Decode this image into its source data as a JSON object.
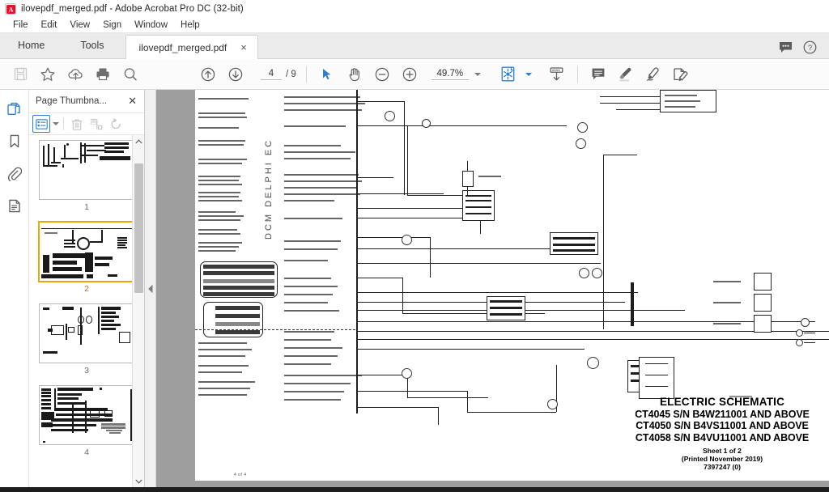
{
  "window": {
    "title": "ilovepdf_merged.pdf - Adobe Acrobat Pro DC (32-bit)",
    "app_icon": "acrobat-logo-icon"
  },
  "menubar": {
    "items": [
      {
        "label": "File"
      },
      {
        "label": "Edit"
      },
      {
        "label": "View"
      },
      {
        "label": "Sign"
      },
      {
        "label": "Window"
      },
      {
        "label": "Help"
      }
    ]
  },
  "tabstrip": {
    "home_label": "Home",
    "tools_label": "Tools",
    "document_tab": "ilovepdf_merged.pdf",
    "close_glyph": "×",
    "right_icons": [
      {
        "name": "feedback-icon"
      },
      {
        "name": "help-icon"
      }
    ]
  },
  "toolbar": {
    "save_tooltip": "Save",
    "add_to_favorites_tooltip": "Add to Favorites",
    "upload_tooltip": "Send file",
    "print_tooltip": "Print File",
    "search_tooltip": "Find",
    "previous_page_tooltip": "Previous Page",
    "next_page_tooltip": "Next Page",
    "page_current": "4",
    "page_total": "/ 9",
    "select_tool_tooltip": "Select Tool",
    "hand_tool_tooltip": "Hand Tool",
    "zoom_out_tooltip": "Zoom Out",
    "zoom_in_tooltip": "Zoom In",
    "zoom_level": "49.7%",
    "page_fit_tooltip": "Fit Page",
    "scroll_mode_tooltip": "Page Display",
    "comment_tooltip": "Add Comment",
    "highlight_tooltip": "Highlight Text",
    "draw_tooltip": "Draw Free Form",
    "fill_sign_tooltip": "Fill & Sign"
  },
  "rail": {
    "items": [
      {
        "name": "page-thumbnails-icon",
        "active": true
      },
      {
        "name": "bookmarks-icon",
        "active": false
      },
      {
        "name": "attachments-icon",
        "active": false
      },
      {
        "name": "layers-icon",
        "active": false
      }
    ]
  },
  "thumbnail_panel": {
    "title": "Page Thumbna...",
    "close_glyph": "✕",
    "tools": [
      {
        "name": "thumbnail-size-options-button"
      },
      {
        "name": "delete-pages-button"
      },
      {
        "name": "extract-pages-button"
      },
      {
        "name": "rotate-page-button"
      }
    ],
    "pages": [
      {
        "label": "1",
        "selected": false
      },
      {
        "label": "2",
        "selected": true
      },
      {
        "label": "3",
        "selected": false
      },
      {
        "label": "4",
        "selected": false
      }
    ]
  },
  "document": {
    "vertical_label": "DCM DELPHI EC",
    "footer_mark": "4 of 4",
    "title_block": {
      "line1": "ELECTRIC SCHEMATIC",
      "line2": "CT4045 S/N B4W211001 AND ABOVE",
      "line3": "CT4050 S/N B4VS11001 AND ABOVE",
      "line4": "CT4058 S/N B4VU11001 AND ABOVE",
      "sheet": "Sheet 1 of 2",
      "printed": "(Printed November 2019)",
      "part_number": "7397247 (0)"
    }
  },
  "colors": {
    "accent_blue": "#2c7fd1",
    "selected_orange": "#f0a30a",
    "chrome_grey": "#ebebeb",
    "viewport_grey": "#9e9e9e"
  }
}
